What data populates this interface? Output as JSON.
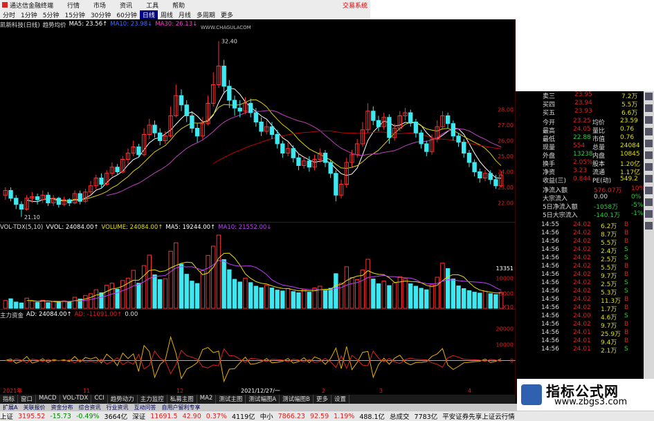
{
  "app_title": "通达信金融终端",
  "title_menus": [
    "行情",
    "市场",
    "资讯",
    "工具",
    "帮助"
  ],
  "trade_label": "交易系统",
  "menubar": {
    "items": [
      "分时",
      "1分钟",
      "5分钟",
      "15分钟",
      "30分钟",
      "60分钟",
      "日线",
      "周线",
      "月线",
      "多周期",
      "更多"
    ],
    "selected": "日线"
  },
  "price_panel": {
    "legend": [
      "凯新科技(日线)",
      "趋势均价",
      "MA5: 23.56↑",
      "MA10: 23.98↓",
      "MA30: 26.13↓"
    ],
    "watermark": "WWW.CHAGULACOM",
    "high_label": "32.40",
    "low_label": "21.10",
    "y_ticks": [
      "28.00",
      "27.00",
      "26.00",
      "25.00",
      "24.00",
      "23.00",
      "22.00"
    ]
  },
  "vol_panel": {
    "legend": [
      "VOL-TDX(5,10)",
      "VVOL: 24084.00↑",
      "VOLUME: 24084.00↑",
      "MA5: 19244.00↑",
      "MA10: 21552.00↓"
    ],
    "y_ticks": [
      "13351",
      "10000",
      "5000",
      "X10"
    ]
  },
  "ind_panel": {
    "legend": [
      "主力资金",
      "AD: 24084.00↑",
      "AD: -11091.00↑",
      "0.00"
    ],
    "y_ticks": [
      "20000",
      "10000",
      "0"
    ]
  },
  "x_axis": {
    "labels": [
      "2021年",
      "11",
      "12",
      "2021/12/27/一",
      "2",
      "3",
      "4"
    ]
  },
  "quote": {
    "asks": [
      {
        "label": "卖三",
        "price": "23.95",
        "vol": "7.2万"
      },
      {
        "label": "买四",
        "price": "23.94",
        "vol": "5.5万"
      },
      {
        "label": "买五",
        "price": "23.93",
        "vol": "6.6万"
      }
    ],
    "stats": [
      {
        "l1": "今开",
        "v1": "23.25",
        "l2": "均价",
        "v2": "23.59"
      },
      {
        "l1": "最高",
        "v1": "24.05",
        "l2": "量比",
        "v2": "0.76"
      },
      {
        "l1": "最低",
        "v1": "22.88",
        "l2": "市值",
        "v2": "0.76"
      },
      {
        "l1": "现量",
        "v1": "554",
        "l2": "总量",
        "v2": "24084"
      },
      {
        "l1": "外盘",
        "v1": "13238",
        "l2": "内盘",
        "v2": "10845"
      },
      {
        "l1": "换手",
        "v1": "2.05%",
        "l2": "股本",
        "v2": "1.20亿"
      },
      {
        "l1": "净资",
        "v1": "3.23",
        "l2": "流通",
        "v2": "1.17亿"
      },
      {
        "l1": "收益(三)",
        "v1": "0.844",
        "l2": "PE(动)",
        "v2": "549.2"
      }
    ],
    "flows": [
      {
        "label": "净流入额",
        "value": "576.07万",
        "pct": "10%"
      },
      {
        "label": "大宗流入",
        "value": "0.00",
        "pct": "0%"
      },
      {
        "label": "5日净流入额",
        "value": "-1058万",
        "pct": "-5%"
      },
      {
        "label": "5日大宗流入",
        "value": "-140.1万",
        "pct": "-1%"
      }
    ],
    "ticks": [
      {
        "t": "14:55",
        "p": "24.02",
        "v": "6.2万",
        "d": "B"
      },
      {
        "t": "14:56",
        "p": "24.02",
        "v": "8.7万",
        "d": "B"
      },
      {
        "t": "14:56",
        "p": "24.02",
        "v": "5.5万",
        "d": "B"
      },
      {
        "t": "14:56",
        "p": "24.02",
        "v": "2.4万",
        "d": "S"
      },
      {
        "t": "14:56",
        "p": "24.02",
        "v": "2.5万",
        "d": "S"
      },
      {
        "t": "14:56",
        "p": "24.02",
        "v": "5.5万",
        "d": "B"
      },
      {
        "t": "14:56",
        "p": "24.02",
        "v": "9.7万",
        "d": "B"
      },
      {
        "t": "14:56",
        "p": "24.02",
        "v": "2.5万",
        "d": "S"
      },
      {
        "t": "14:56",
        "p": "24.02",
        "v": "5.3万",
        "d": "S"
      },
      {
        "t": "14:56",
        "p": "24.02",
        "v": "11.3万",
        "d": "B"
      },
      {
        "t": "14:56",
        "p": "24.02",
        "v": "1.7万",
        "d": "B"
      },
      {
        "t": "14:56",
        "p": "24.00",
        "v": "4.6万",
        "d": "S"
      },
      {
        "t": "14:56",
        "p": "24.02",
        "v": "9.7万",
        "d": "B"
      },
      {
        "t": "14:56",
        "p": "24.01",
        "v": "25.9万",
        "d": "B"
      },
      {
        "t": "14:56",
        "p": "24.01",
        "v": "9.4万",
        "d": "B"
      },
      {
        "t": "14:56",
        "p": "24.01",
        "v": "2.1万",
        "d": "S"
      }
    ]
  },
  "bottom_tabs": [
    "指标",
    "窗口",
    "MACD",
    "VOL-TDX",
    "CCI",
    "趋势动力",
    "主力监控",
    "私募主图",
    "MA2",
    "测试主图",
    "测试幅图A",
    "测试幅图B",
    "更多",
    "设置"
  ],
  "bottom_tabs2": [
    "扩展A",
    "关联报价",
    "资金分布",
    "综合资讯",
    "行业资讯",
    "互动问答",
    "自用户留利专享"
  ],
  "status": [
    {
      "text": "上证",
      "cls": ""
    },
    {
      "text": "3195.52",
      "cls": "red"
    },
    {
      "text": "-15.73",
      "cls": "grn"
    },
    {
      "text": "-0.49%",
      "cls": "grn"
    },
    {
      "text": "3664亿",
      "cls": ""
    },
    {
      "text": "深证",
      "cls": ""
    },
    {
      "text": "11691.5",
      "cls": "red"
    },
    {
      "text": "42.90",
      "cls": "red"
    },
    {
      "text": "0.37%",
      "cls": "red"
    },
    {
      "text": "4119亿",
      "cls": ""
    },
    {
      "text": "中小",
      "cls": ""
    },
    {
      "text": "7866.23",
      "cls": "red"
    },
    {
      "text": "92.59",
      "cls": "red"
    },
    {
      "text": "1.19%",
      "cls": "red"
    },
    {
      "text": "488.1亿",
      "cls": ""
    },
    {
      "text": "总成交",
      "cls": ""
    },
    {
      "text": "7783亿",
      "cls": ""
    },
    {
      "text": "平安证券先享上证云行情",
      "cls": ""
    }
  ],
  "website": {
    "title": "指标公式网",
    "url": "www.zbgs3.com"
  },
  "colors": {
    "up": "#ff3030",
    "down": "#3ee8f0",
    "ma5": "#ffffff",
    "ma10": "#e0d000",
    "ma30": "#c040c0",
    "ma_long": "#c00000"
  },
  "chart_data": {
    "type": "candlestick",
    "y_range": [
      21.0,
      33.0
    ],
    "candles": [
      [
        22.5,
        22.8,
        22.2,
        23.0
      ],
      [
        22.8,
        22.3,
        22.1,
        23.0
      ],
      [
        22.3,
        21.9,
        21.6,
        22.5
      ],
      [
        21.9,
        21.6,
        21.1,
        22.1
      ],
      [
        21.6,
        22.3,
        21.5,
        22.5
      ],
      [
        22.3,
        22.4,
        22.0,
        22.7
      ],
      [
        22.4,
        22.2,
        21.9,
        22.6
      ],
      [
        22.2,
        22.5,
        22.0,
        22.8
      ],
      [
        22.5,
        22.0,
        21.8,
        22.7
      ],
      [
        22.0,
        22.3,
        21.8,
        22.5
      ],
      [
        22.3,
        21.9,
        21.7,
        22.4
      ],
      [
        21.9,
        22.2,
        21.8,
        22.4
      ],
      [
        22.2,
        22.0,
        21.8,
        22.3
      ],
      [
        22.0,
        22.6,
        21.9,
        22.8
      ],
      [
        22.6,
        22.1,
        21.9,
        22.8
      ],
      [
        22.1,
        22.7,
        22.0,
        22.9
      ],
      [
        22.7,
        23.1,
        22.5,
        23.4
      ],
      [
        23.1,
        23.6,
        22.9,
        23.8
      ],
      [
        23.6,
        23.2,
        23.0,
        23.9
      ],
      [
        23.2,
        23.9,
        23.1,
        24.1
      ],
      [
        23.9,
        24.3,
        23.7,
        24.6
      ],
      [
        24.3,
        24.0,
        23.8,
        24.5
      ],
      [
        24.0,
        24.8,
        23.9,
        25.0
      ],
      [
        24.8,
        25.2,
        24.5,
        25.5
      ],
      [
        25.2,
        25.6,
        25.0,
        26.0
      ],
      [
        25.6,
        25.1,
        24.9,
        25.8
      ],
      [
        25.1,
        26.4,
        25.0,
        26.8
      ],
      [
        26.4,
        27.0,
        26.1,
        27.4
      ],
      [
        27.0,
        26.5,
        26.2,
        27.3
      ],
      [
        26.5,
        26.0,
        25.7,
        26.8
      ],
      [
        26.0,
        26.3,
        25.8,
        26.6
      ],
      [
        26.3,
        27.6,
        26.2,
        28.2
      ],
      [
        27.6,
        28.9,
        27.5,
        29.6
      ],
      [
        28.9,
        28.3,
        27.9,
        29.3
      ],
      [
        28.3,
        27.6,
        27.2,
        28.6
      ],
      [
        27.6,
        26.8,
        26.5,
        27.9
      ],
      [
        26.8,
        26.3,
        25.9,
        27.1
      ],
      [
        26.3,
        27.1,
        26.1,
        27.5
      ],
      [
        27.1,
        28.4,
        27.0,
        28.9
      ],
      [
        28.4,
        29.6,
        28.2,
        30.4
      ],
      [
        29.6,
        30.8,
        29.4,
        32.4
      ],
      [
        30.8,
        29.5,
        29.0,
        31.2
      ],
      [
        29.5,
        28.6,
        28.1,
        29.9
      ],
      [
        28.6,
        28.1,
        27.6,
        28.9
      ],
      [
        28.1,
        27.9,
        27.5,
        28.6
      ],
      [
        27.9,
        28.4,
        27.7,
        28.8
      ],
      [
        28.4,
        27.8,
        27.5,
        28.7
      ],
      [
        27.8,
        27.2,
        26.9,
        28.1
      ],
      [
        27.2,
        26.6,
        26.3,
        27.5
      ],
      [
        26.6,
        26.9,
        26.4,
        27.3
      ],
      [
        26.9,
        26.4,
        26.1,
        27.2
      ],
      [
        26.4,
        25.8,
        25.5,
        26.7
      ],
      [
        25.8,
        25.2,
        24.9,
        26.0
      ],
      [
        25.2,
        25.5,
        25.0,
        25.9
      ],
      [
        25.5,
        24.9,
        24.6,
        25.7
      ],
      [
        24.9,
        24.4,
        24.1,
        25.2
      ],
      [
        24.4,
        24.7,
        24.2,
        25.0
      ],
      [
        24.7,
        24.3,
        24.0,
        25.0
      ],
      [
        24.3,
        24.8,
        24.1,
        25.1
      ],
      [
        24.8,
        25.2,
        24.6,
        25.5
      ],
      [
        25.2,
        24.6,
        24.3,
        25.4
      ],
      [
        24.6,
        23.9,
        23.6,
        24.8
      ],
      [
        23.9,
        22.5,
        22.1,
        24.1
      ],
      [
        22.5,
        23.2,
        22.3,
        23.5
      ],
      [
        23.2,
        24.6,
        23.0,
        24.9
      ],
      [
        24.6,
        25.1,
        24.3,
        25.4
      ],
      [
        25.1,
        25.8,
        24.9,
        26.1
      ],
      [
        25.8,
        26.7,
        25.6,
        27.2
      ],
      [
        26.7,
        27.9,
        26.5,
        28.4
      ],
      [
        27.9,
        27.3,
        27.0,
        28.2
      ],
      [
        27.3,
        26.9,
        26.6,
        27.6
      ],
      [
        26.9,
        27.5,
        26.7,
        27.8
      ],
      [
        27.5,
        26.2,
        25.8,
        27.7
      ],
      [
        26.2,
        26.8,
        26.0,
        27.1
      ],
      [
        26.8,
        27.6,
        26.6,
        27.9
      ],
      [
        27.6,
        27.8,
        27.3,
        28.1
      ],
      [
        27.8,
        27.2,
        26.9,
        28.0
      ],
      [
        27.2,
        26.5,
        26.2,
        27.4
      ],
      [
        26.5,
        25.8,
        25.5,
        26.7
      ],
      [
        25.8,
        25.3,
        25.0,
        26.0
      ],
      [
        25.3,
        26.1,
        25.1,
        26.4
      ],
      [
        26.1,
        26.9,
        25.9,
        27.3
      ],
      [
        26.9,
        27.6,
        26.7,
        27.9
      ],
      [
        27.6,
        27.1,
        26.8,
        27.8
      ],
      [
        27.1,
        26.3,
        26.0,
        27.3
      ],
      [
        26.3,
        25.9,
        25.6,
        26.5
      ],
      [
        25.9,
        25.2,
        24.9,
        26.1
      ],
      [
        25.2,
        24.6,
        24.3,
        25.4
      ],
      [
        24.6,
        24.0,
        23.7,
        24.8
      ],
      [
        24.0,
        23.6,
        23.3,
        24.2
      ],
      [
        23.6,
        23.9,
        23.4,
        24.1
      ],
      [
        23.9,
        23.5,
        23.2,
        24.1
      ],
      [
        23.5,
        23.1,
        22.9,
        23.8
      ],
      [
        23.1,
        23.8,
        23.0,
        24.05
      ]
    ],
    "volumes": [
      2600,
      3200,
      2100,
      1800,
      3400,
      2400,
      2000,
      2700,
      1900,
      2300,
      2200,
      2500,
      2100,
      3700,
      3100,
      4300,
      4900,
      6200,
      5200,
      7700,
      8400,
      6400,
      9300,
      10100,
      12700,
      8400,
      14300,
      17800,
      11200,
      9600,
      9900,
      19100,
      21900,
      14800,
      11400,
      9100,
      8300,
      12600,
      17700,
      20800,
      24500,
      16300,
      12900,
      9700,
      8800,
      10100,
      8600,
      7400,
      6900,
      7700,
      6800,
      6100,
      5800,
      6600,
      5600,
      5200,
      6300,
      5400,
      6800,
      7400,
      5900,
      6700,
      11600,
      8400,
      13900,
      10300,
      9600,
      12800,
      16400,
      9800,
      8200,
      9100,
      7600,
      8500,
      10600,
      9900,
      8200,
      7400,
      6700,
      6200,
      7800,
      10400,
      15100,
      13300,
      9800,
      7500,
      6600,
      5900,
      5400,
      5100,
      5700,
      4900,
      4600,
      5300
    ],
    "vol_max": 24500,
    "ad_range": [
      -15000,
      25000
    ]
  }
}
